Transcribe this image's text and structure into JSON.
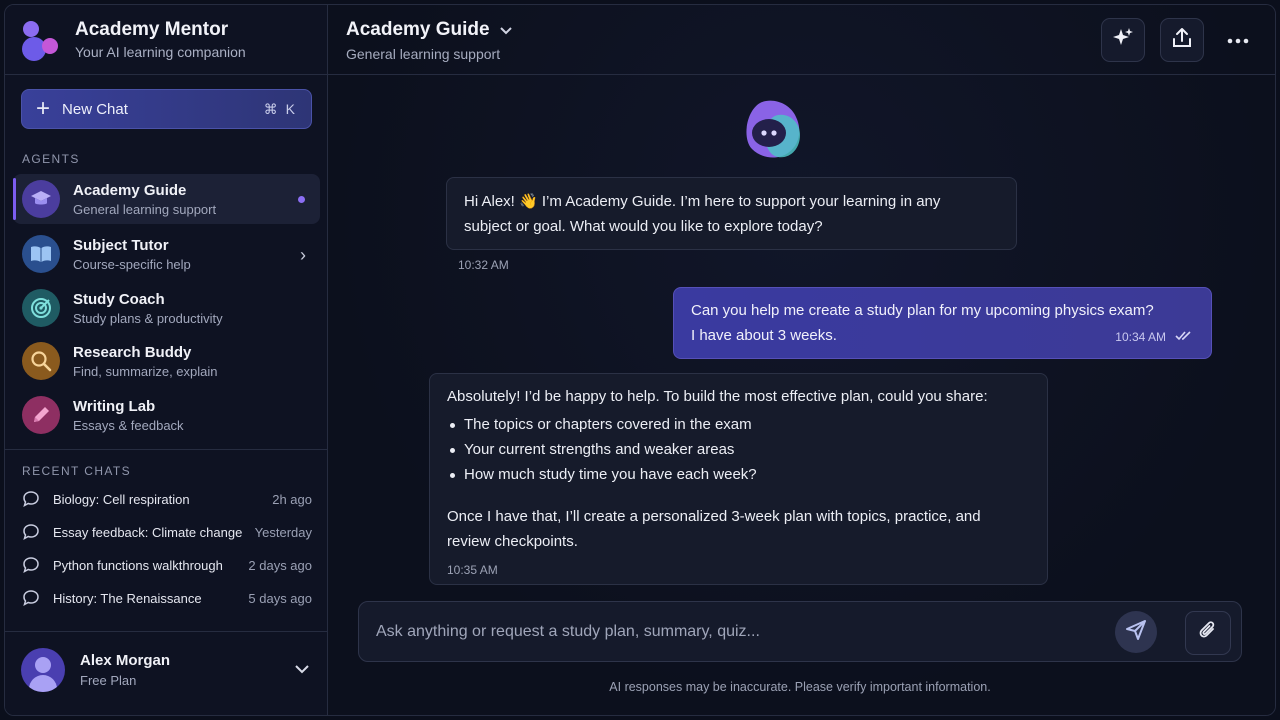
{
  "brand": {
    "title": "Academy Mentor",
    "subtitle": "Your AI learning companion"
  },
  "new_chat": {
    "label": "New Chat",
    "shortcut": "⌘ K"
  },
  "agents_label": "AGENTS",
  "agents": [
    {
      "name": "Academy Guide",
      "desc": "General learning support",
      "icon": "graduation-cap-icon",
      "color": "#4b3d9e",
      "active": true
    },
    {
      "name": "Subject Tutor",
      "desc": "Course-specific help",
      "icon": "book-icon",
      "color": "#2a4f8e"
    },
    {
      "name": "Study Coach",
      "desc": "Study plans & productivity",
      "icon": "target-icon",
      "color": "#1f5b63"
    },
    {
      "name": "Research Buddy",
      "desc": "Find, summarize, explain",
      "icon": "search-icon",
      "color": "#8a5a1e"
    },
    {
      "name": "Writing Lab",
      "desc": "Essays & feedback",
      "icon": "pencil-icon",
      "color": "#8e2f62"
    }
  ],
  "recent_label": "RECENT CHATS",
  "recent_chats": [
    {
      "title": "Biology: Cell respiration",
      "time": "2h ago"
    },
    {
      "title": "Essay feedback: Climate change",
      "time": "Yesterday"
    },
    {
      "title": "Python functions walkthrough",
      "time": "2 days ago"
    },
    {
      "title": "History: The Renaissance",
      "time": "5 days ago"
    }
  ],
  "user": {
    "name": "Alex Morgan",
    "plan": "Free Plan"
  },
  "header": {
    "title": "Academy Guide",
    "subtitle": "General learning support"
  },
  "messages": {
    "m1": {
      "line1": "Hi Alex! 👋 I’m Academy Guide. I’m here to support your learning in any",
      "line2": "subject or goal. What would you like to explore today?",
      "time": "10:32 AM"
    },
    "m2": {
      "line1": "Can you help me create a study plan for my upcoming physics exam?",
      "line2": "I have about 3 weeks.",
      "time": "10:34 AM"
    },
    "m3": {
      "intro": "Absolutely! I’d be happy to help. To build the most effective plan, could you share:",
      "bullets": [
        "The topics or chapters covered in the exam",
        "Your current strengths and weaker areas",
        "How much study time you have each week?"
      ],
      "outro1": "Once I have that, I’ll create a personalized 3-week plan with topics, practice, and",
      "outro2": "review checkpoints.",
      "time": "10:35 AM"
    }
  },
  "composer": {
    "placeholder": "Ask anything or request a study plan, summary, quiz..."
  },
  "disclaimer": "AI responses may be inaccurate. Please verify important information.",
  "colors": {
    "accent": "#7c5df0",
    "user_bubble": "#3a3aa0"
  }
}
